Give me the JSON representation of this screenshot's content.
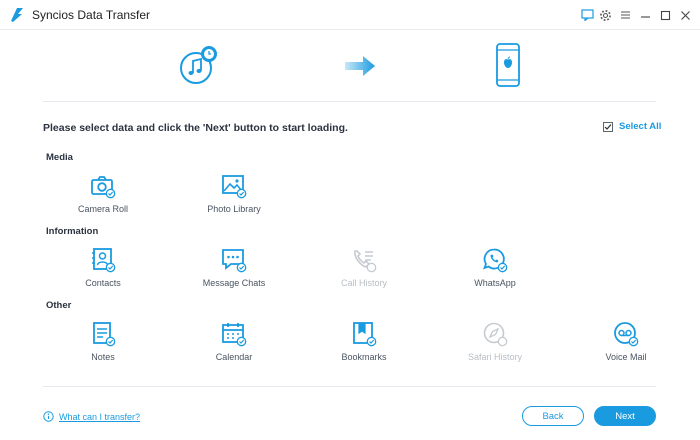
{
  "window": {
    "title": "Syncios Data Transfer"
  },
  "title_controls": [
    "feedback-icon",
    "settings-gear-icon",
    "menu-icon",
    "minimize-icon",
    "maximize-icon",
    "close-icon"
  ],
  "instruction": "Please select data and click the 'Next' button to start loading.",
  "select_all": {
    "label": "Select All",
    "checked": true
  },
  "sections": [
    {
      "title": "Media",
      "items": [
        {
          "label": "Camera Roll",
          "icon": "camera-icon",
          "enabled": true,
          "checked": true
        },
        {
          "label": "Photo Library",
          "icon": "photo-icon",
          "enabled": true,
          "checked": true
        }
      ]
    },
    {
      "title": "Information",
      "items": [
        {
          "label": "Contacts",
          "icon": "contacts-icon",
          "enabled": true,
          "checked": true
        },
        {
          "label": "Message Chats",
          "icon": "message-icon",
          "enabled": true,
          "checked": true
        },
        {
          "label": "Call History",
          "icon": "call-history-icon",
          "enabled": false,
          "checked": false
        },
        {
          "label": "WhatsApp",
          "icon": "whatsapp-icon",
          "enabled": true,
          "checked": true
        }
      ]
    },
    {
      "title": "Other",
      "items": [
        {
          "label": "Notes",
          "icon": "notes-icon",
          "enabled": true,
          "checked": true
        },
        {
          "label": "Calendar",
          "icon": "calendar-icon",
          "enabled": true,
          "checked": true
        },
        {
          "label": "Bookmarks",
          "icon": "bookmark-icon",
          "enabled": true,
          "checked": true
        },
        {
          "label": "Safari History",
          "icon": "safari-icon",
          "enabled": false,
          "checked": false
        },
        {
          "label": "Voice Mail",
          "icon": "voicemail-icon",
          "enabled": true,
          "checked": true
        }
      ]
    }
  ],
  "footer": {
    "help_label": "What can I transfer?",
    "back_label": "Back",
    "next_label": "Next"
  },
  "colors": {
    "accent": "#1a9be0",
    "disabled": "#c5cbd1",
    "text": "#2b3340"
  }
}
